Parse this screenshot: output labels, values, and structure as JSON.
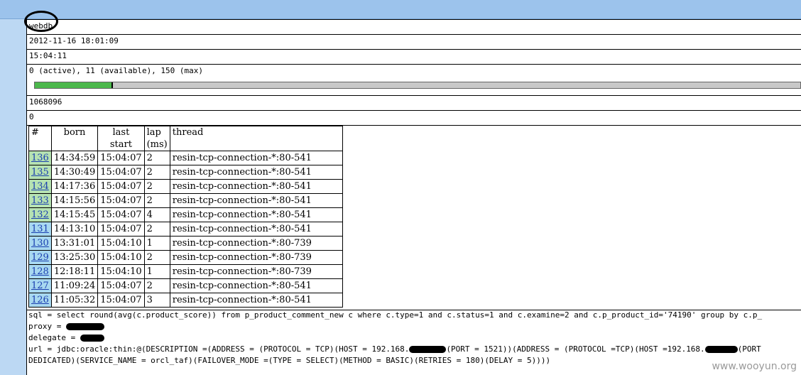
{
  "pool": {
    "name": "webdb",
    "created": "2012-11-16 18:01:09",
    "time": "15:04:11",
    "connections": "0 (active), 11 (available), 150 (max)",
    "progress_fraction": 0.1,
    "count": "1068096",
    "failed": "0"
  },
  "table": {
    "headers": [
      "#",
      "born",
      "last\nstart",
      "lap\n(ms)",
      "thread"
    ],
    "rows": [
      [
        "136",
        "14:34:59",
        "15:04:07",
        "2",
        "resin-tcp-connection-*:80-541"
      ],
      [
        "135",
        "14:30:49",
        "15:04:07",
        "2",
        "resin-tcp-connection-*:80-541"
      ],
      [
        "134",
        "14:17:36",
        "15:04:07",
        "2",
        "resin-tcp-connection-*:80-541"
      ],
      [
        "133",
        "14:15:56",
        "15:04:07",
        "2",
        "resin-tcp-connection-*:80-541"
      ],
      [
        "132",
        "14:15:45",
        "15:04:07",
        "4",
        "resin-tcp-connection-*:80-541"
      ],
      [
        "131",
        "14:13:10",
        "15:04:07",
        "2",
        "resin-tcp-connection-*:80-541"
      ],
      [
        "130",
        "13:31:01",
        "15:04:10",
        "1",
        "resin-tcp-connection-*:80-739"
      ],
      [
        "129",
        "13:25:30",
        "15:04:10",
        "2",
        "resin-tcp-connection-*:80-739"
      ],
      [
        "128",
        "12:18:11",
        "15:04:10",
        "1",
        "resin-tcp-connection-*:80-739"
      ],
      [
        "127",
        "11:09:24",
        "15:04:07",
        "2",
        "resin-tcp-connection-*:80-541"
      ],
      [
        "126",
        "11:05:32",
        "15:04:07",
        "3",
        "resin-tcp-connection-*:80-541"
      ]
    ]
  },
  "details": {
    "sql": "sql = select round(avg(c.product_score)) from p_product_comment_new c where c.type=1 and c.status=1 and c.examine=2 and c.p_product_id='74190' group by c.p_",
    "proxy": "proxy = ",
    "delegate": "delegate = ",
    "url_a": "url = jdbc:oracle:thin:@(DESCRIPTION =(ADDRESS = (PROTOCOL = TCP)(HOST = 192.168.",
    "url_b": "(PORT = 1521))(ADDRESS = (PROTOCOL =TCP)(HOST =192.168.",
    "url_c": "(PORT",
    "url_line2": "DEDICATED)(SERVICE_NAME = orcl_taf)(FAILOVER_MODE =(TYPE = SELECT)(METHOD = BASIC)(RETRIES = 180)(DELAY = 5))))"
  },
  "watermark": "www.wooyun.org"
}
